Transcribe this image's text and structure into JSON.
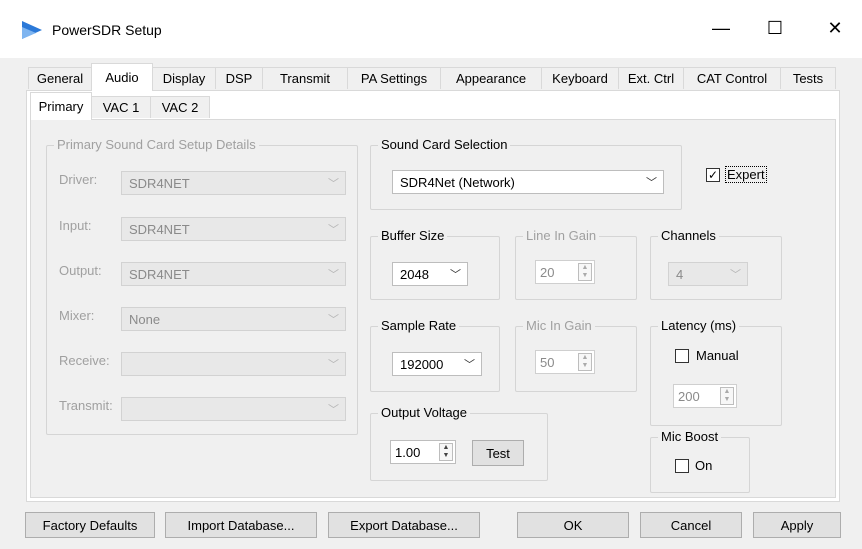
{
  "window": {
    "title": "PowerSDR Setup",
    "controls": {
      "minimize": "—",
      "maximize": "☐",
      "close": "✕"
    }
  },
  "tabs": [
    "General",
    "Audio",
    "Display",
    "DSP",
    "Transmit",
    "PA Settings",
    "Appearance",
    "Keyboard",
    "Ext. Ctrl",
    "CAT Control",
    "Tests"
  ],
  "subtabs": [
    "Primary",
    "VAC 1",
    "VAC 2"
  ],
  "primary_group": {
    "title": "Primary Sound Card Setup Details",
    "driver": {
      "label": "Driver:",
      "value": "SDR4NET"
    },
    "input": {
      "label": "Input:",
      "value": "SDR4NET"
    },
    "output": {
      "label": "Output:",
      "value": "SDR4NET"
    },
    "mixer": {
      "label": "Mixer:",
      "value": "None"
    },
    "receive": {
      "label": "Receive:",
      "value": ""
    },
    "transmit": {
      "label": "Transmit:",
      "value": ""
    }
  },
  "sound_card": {
    "title": "Sound Card Selection",
    "value": "SDR4Net (Network)"
  },
  "expert": {
    "label": "Expert",
    "checked": true
  },
  "buffer_size": {
    "title": "Buffer Size",
    "value": "2048"
  },
  "line_in_gain": {
    "title": "Line In Gain",
    "value": "20"
  },
  "channels": {
    "title": "Channels",
    "value": "4"
  },
  "sample_rate": {
    "title": "Sample Rate",
    "value": "192000"
  },
  "mic_in_gain": {
    "title": "Mic In Gain",
    "value": "50"
  },
  "latency": {
    "title": "Latency (ms)",
    "manual_label": "Manual",
    "manual_checked": false,
    "value": "200"
  },
  "output_voltage": {
    "title": "Output Voltage",
    "value": "1.00",
    "test_label": "Test"
  },
  "mic_boost": {
    "title": "Mic Boost",
    "on_label": "On",
    "checked": false
  },
  "footer": {
    "factory_defaults": "Factory Defaults",
    "import_db": "Import Database...",
    "export_db": "Export Database...",
    "ok": "OK",
    "cancel": "Cancel",
    "apply": "Apply"
  },
  "colors": {
    "accent": "#2b79d8",
    "window_bg": "#f0f0f0",
    "disabled_text": "#a0a0a0"
  }
}
